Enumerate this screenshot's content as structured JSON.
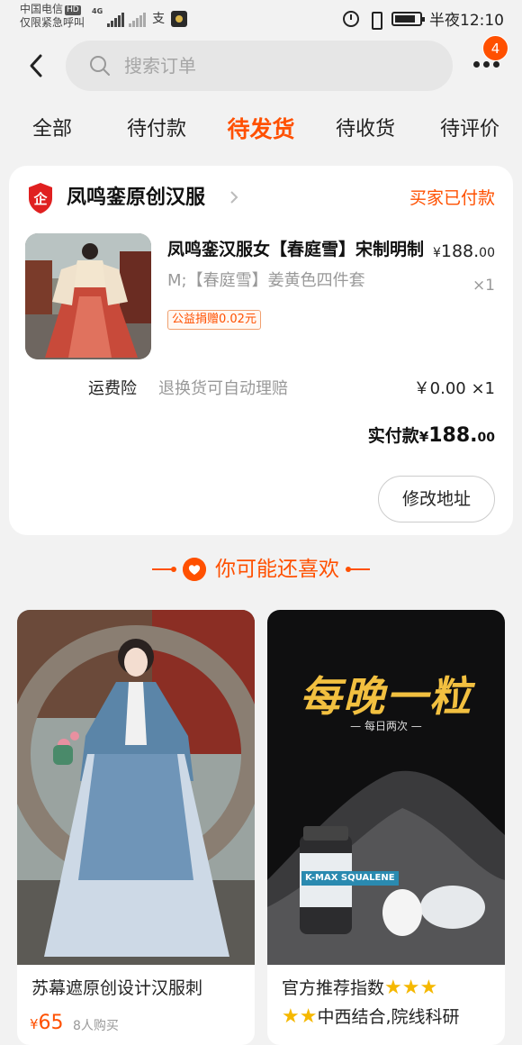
{
  "status_bar": {
    "carrier_line1": "中国电信",
    "carrier_hd": "HD",
    "carrier_line2": "仅限紧急呼叫",
    "net_type": "4G",
    "alipay_glyph": "支",
    "time": "半夜12:10",
    "battery_level": 0.85
  },
  "header": {
    "search_placeholder": "搜索订单",
    "more_badge": "4"
  },
  "tabs": [
    {
      "label": "全部"
    },
    {
      "label": "待付款"
    },
    {
      "label": "待发货",
      "active": true
    },
    {
      "label": "待收货"
    },
    {
      "label": "待评价"
    }
  ],
  "order": {
    "shop_logo_char": "企",
    "shop_name": "凤鸣銮原创汉服",
    "status": "买家已付款",
    "product_title": "凤鸣銮汉服女【春庭雪】宋制明制",
    "price_currency": "¥",
    "price_int": "188.",
    "price_dec": "00",
    "sku": "M;【春庭雪】姜黄色四件套",
    "qty": "×1",
    "charity_tag": "公益捐赠0.02元",
    "insurance_label": "运费险",
    "insurance_desc": "退换货可自动理赔",
    "insurance_price": "￥0.00 ×1",
    "paid_label": "实付款",
    "paid_currency": "¥",
    "paid_int": "188.",
    "paid_dec": "00",
    "modify_button": "修改地址"
  },
  "recommend": {
    "heading": "你可能还喜欢",
    "items": [
      {
        "title": "苏幕遮原创设计汉服刺",
        "price_currency": "¥",
        "price": "65",
        "buyers": "8人购买"
      },
      {
        "poster_title": "每晚一粒",
        "poster_sub": "— 每日两次 —",
        "brand": "K-MAX SQUALENE",
        "title_line1": "官方推荐指数",
        "stars_line1": "★★★",
        "stars_line2": "★★",
        "title_line2": "中西结合,院线科研"
      }
    ]
  },
  "colors": {
    "accent": "#ff5000",
    "background": "#f2f2f2",
    "muted_text": "#999999"
  }
}
